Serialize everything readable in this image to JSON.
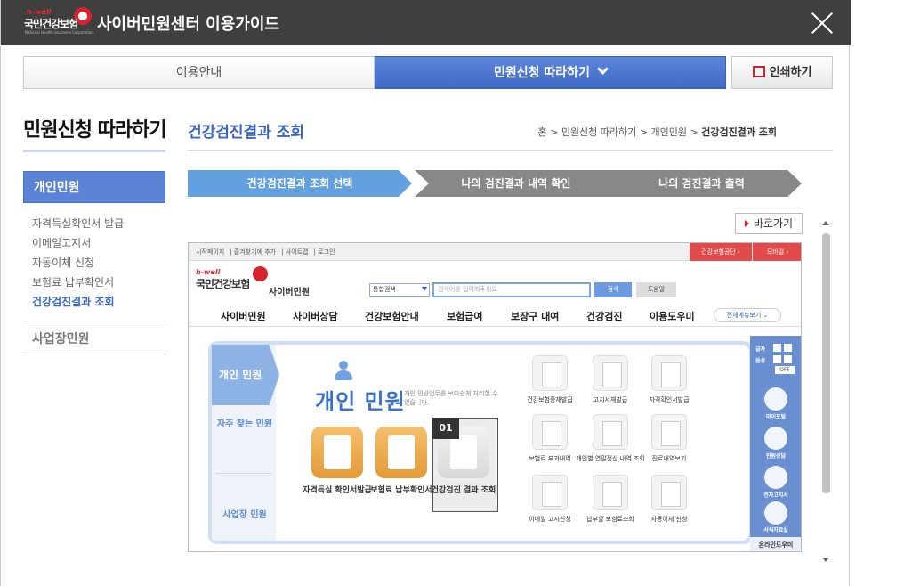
{
  "window": {
    "title": "사이버민원센터 이용가이드",
    "logo": {
      "brand": "h-well",
      "name": "국민건강보험",
      "sub": "National Health Insurance Corporation"
    }
  },
  "tabs": {
    "guide": "이용안내",
    "follow": "민원신청 따라하기",
    "print": "인쇄하기"
  },
  "sidebar": {
    "title": "민원신청 따라하기",
    "active": "개인민원",
    "items": [
      "자격득실확인서 발급",
      "이메일고지서",
      "자동이체 신청",
      "보험료 납부확인서",
      "건강검진결과 조회"
    ],
    "section2": "사업장민원"
  },
  "main": {
    "title": "건강검진결과 조회",
    "breadcrumb": [
      "홈",
      "민원신청 따라하기",
      "개인민원",
      "건강검진결과 조회"
    ],
    "steps": [
      "건강검진결과 조회 선택",
      "나의 검진결과 내역 확인",
      "나의 검진결과 출력"
    ],
    "back": "바로가기"
  },
  "shot": {
    "toplinks": [
      "시작페이지",
      "즐겨찾기에 추가",
      "사이트맵",
      "로그인"
    ],
    "gov": "건강보험공단 ›",
    "mobile": "모바일 ›",
    "logo_brand": "h-well",
    "logo_name": "국민건강보험",
    "service": "사이버민원",
    "search_select": "통합검색",
    "search_placeholder": "검색어를 입력해주세요",
    "search_btn": "검색",
    "help_btn": "도움말",
    "nav": [
      "사이버민원",
      "사이버상담",
      "건강보험안내",
      "보험급여",
      "보장구 대여",
      "건강검진",
      "이용도우미"
    ],
    "nav_all": "전체메뉴보기 ⌄",
    "left_tabs": [
      "개인 민원",
      "자주 찾는 민원",
      "사업장 민원"
    ],
    "panel_title": "개인 민원",
    "panel_desc": "개인 민원업무를 보다쉽게 처리할 수 있습니다.",
    "big": [
      "자격득실 확인서발급",
      "보험료 납부확인서",
      "건강검진 결과 조회"
    ],
    "badge": "01",
    "small": [
      "건강보험증재발급",
      "고지서재발급",
      "자격확인서발급",
      "보험료 부과내역",
      "개인별 연말정산 내역 조회",
      "진료내역보기",
      "이메일 고지신청",
      "납부할 보험료조회",
      "자동이체 신청"
    ],
    "right": {
      "font": "글자",
      "sound": "음성",
      "off": "OFF",
      "items": [
        "마이포털",
        "민원상담",
        "전자고지서",
        "서식자료실"
      ],
      "bottom": "온라인도우미"
    }
  }
}
